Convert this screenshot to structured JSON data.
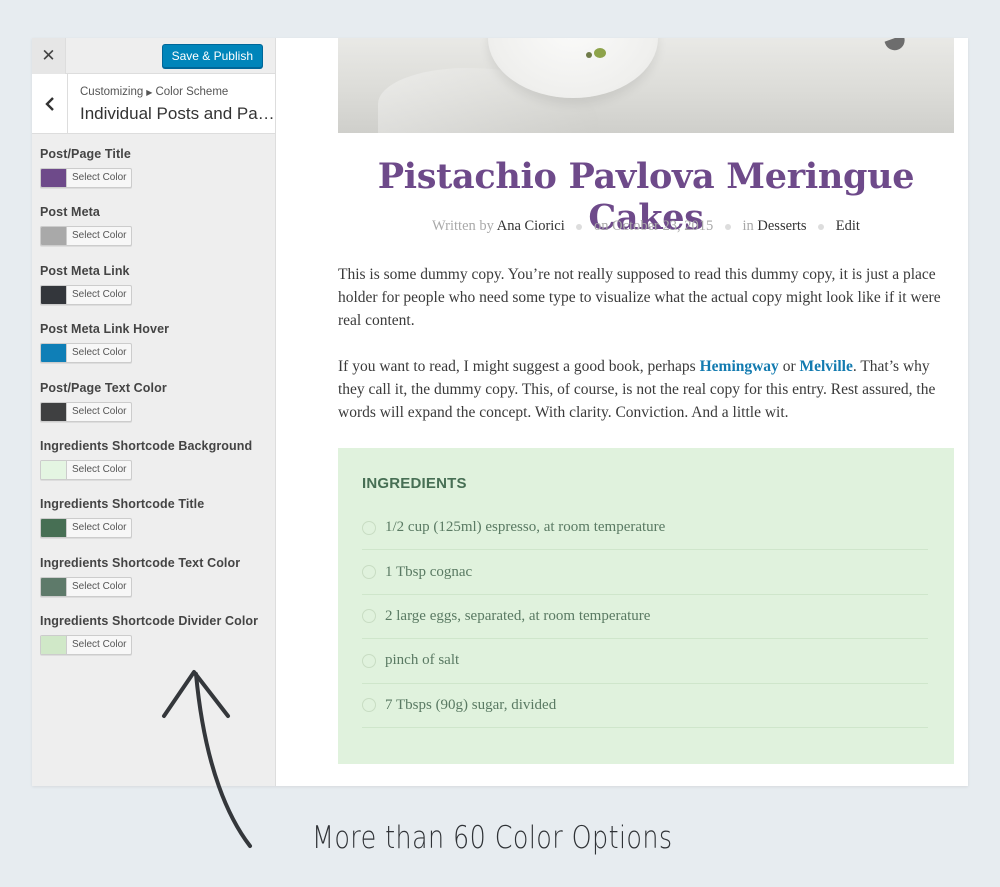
{
  "customizer": {
    "close_symbol": "✕",
    "publish_label": "Save & Publish",
    "breadcrumb": [
      "Customizing",
      "Color Scheme"
    ],
    "section_title": "Individual Posts and Pag…",
    "controls": [
      {
        "label": "Post/Page Title",
        "button": "Select Color",
        "color": "#6e4a8a"
      },
      {
        "label": "Post Meta",
        "button": "Select Color",
        "color": "#a9a9a9"
      },
      {
        "label": "Post Meta Link",
        "button": "Select Color",
        "color": "#33363b"
      },
      {
        "label": "Post Meta Link Hover",
        "button": "Select Color",
        "color": "#0f7fb7"
      },
      {
        "label": "Post/Page Text Color",
        "button": "Select Color",
        "color": "#3f4041"
      },
      {
        "label": "Ingredients Shortcode Background",
        "button": "Select Color",
        "color": "#e4f5e2"
      },
      {
        "label": "Ingredients Shortcode Title",
        "button": "Select Color",
        "color": "#476f54"
      },
      {
        "label": "Ingredients Shortcode Text Color",
        "button": "Select Color",
        "color": "#5e7a6a"
      },
      {
        "label": "Ingredients Shortcode Divider Color",
        "button": "Select Color",
        "color": "#d0e8c8"
      }
    ]
  },
  "post": {
    "title": "Pistachio Pavlova Meringue Cakes",
    "written_by": "Written by",
    "author": "Ana Ciorici",
    "date": "on October 23, 2015",
    "in_label": "in",
    "category": "Desserts",
    "edit": "Edit",
    "p1": "This is some dummy copy. You’re not really supposed to read this dummy copy, it is just a place holder for people who need some type to visualize what the actual copy might look like if it were real content.",
    "p2_a": "If you want to read, I might suggest a good book, perhaps ",
    "link1": "Hemingway",
    "p2_b": " or ",
    "link2": "Melville",
    "p2_c": ". That’s why they call it, the dummy copy. This, of course, is not the real copy for this entry. Rest assured, the words will expand the concept. With clarity. Conviction. And a little wit.",
    "ingredients_title": "INGREDIENTS",
    "ingredients": [
      "1/2 cup (125ml) espresso, at room temperature",
      "1 Tbsp cognac",
      "2 large eggs, separated, at room temperature",
      "pinch of salt",
      "7 Tbsps (90g) sugar, divided"
    ]
  },
  "annotation": "More than 60 Color Options"
}
